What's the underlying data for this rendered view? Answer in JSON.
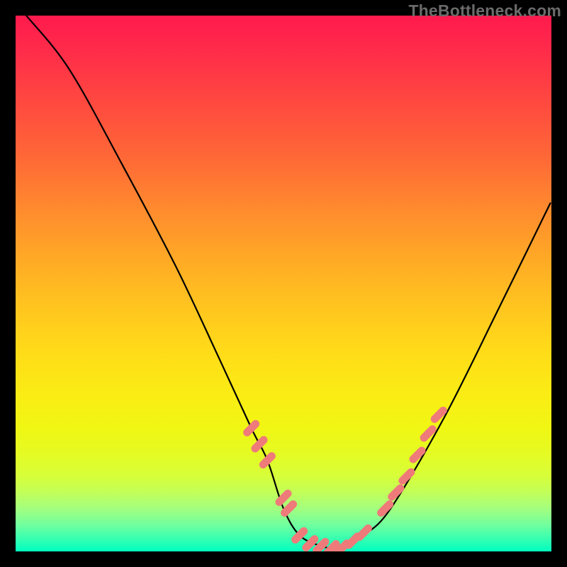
{
  "watermark": "TheBottleneck.com",
  "chart_data": {
    "type": "line",
    "title": "",
    "xlabel": "",
    "ylabel": "",
    "xlim": [
      0,
      100
    ],
    "ylim": [
      0,
      100
    ],
    "series": [
      {
        "name": "bottleneck-curve",
        "x": [
          2,
          10,
          20,
          30,
          38,
          44,
          47,
          50,
          53,
          57,
          60,
          62,
          65,
          70,
          80,
          90,
          99.8
        ],
        "y": [
          100,
          90,
          72,
          53,
          36,
          23,
          17,
          8,
          3,
          1,
          0.5,
          1,
          3,
          8,
          25,
          45,
          65
        ]
      }
    ],
    "markers": {
      "name": "highlight-dots",
      "color": "#ef7a7a",
      "points": [
        {
          "x": 44,
          "y": 23
        },
        {
          "x": 45.5,
          "y": 20
        },
        {
          "x": 47,
          "y": 17
        },
        {
          "x": 50,
          "y": 10
        },
        {
          "x": 51,
          "y": 8
        },
        {
          "x": 53,
          "y": 3
        },
        {
          "x": 55,
          "y": 1.5
        },
        {
          "x": 57,
          "y": 1
        },
        {
          "x": 59,
          "y": 0.6
        },
        {
          "x": 61,
          "y": 0.7
        },
        {
          "x": 63,
          "y": 2
        },
        {
          "x": 65,
          "y": 3.5
        },
        {
          "x": 69,
          "y": 8
        },
        {
          "x": 71,
          "y": 11
        },
        {
          "x": 73,
          "y": 14
        },
        {
          "x": 75,
          "y": 18
        },
        {
          "x": 77,
          "y": 22
        },
        {
          "x": 79,
          "y": 25.5
        }
      ]
    }
  }
}
